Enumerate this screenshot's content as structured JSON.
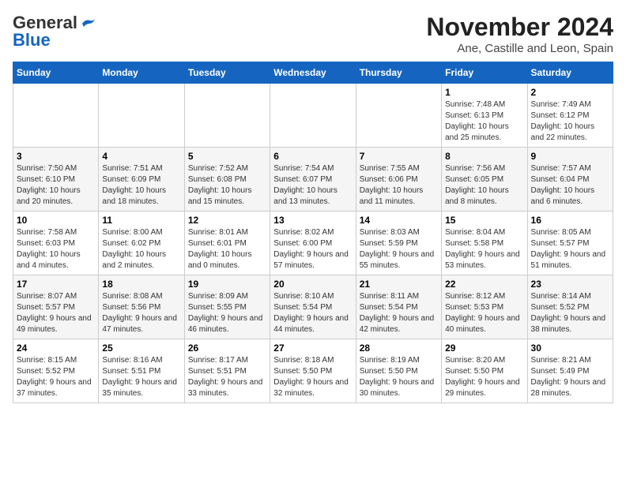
{
  "logo": {
    "general": "General",
    "blue": "Blue"
  },
  "title": "November 2024",
  "location": "Ane, Castille and Leon, Spain",
  "days_of_week": [
    "Sunday",
    "Monday",
    "Tuesday",
    "Wednesday",
    "Thursday",
    "Friday",
    "Saturday"
  ],
  "weeks": [
    [
      {
        "day": "",
        "info": ""
      },
      {
        "day": "",
        "info": ""
      },
      {
        "day": "",
        "info": ""
      },
      {
        "day": "",
        "info": ""
      },
      {
        "day": "",
        "info": ""
      },
      {
        "day": "1",
        "info": "Sunrise: 7:48 AM\nSunset: 6:13 PM\nDaylight: 10 hours and 25 minutes."
      },
      {
        "day": "2",
        "info": "Sunrise: 7:49 AM\nSunset: 6:12 PM\nDaylight: 10 hours and 22 minutes."
      }
    ],
    [
      {
        "day": "3",
        "info": "Sunrise: 7:50 AM\nSunset: 6:10 PM\nDaylight: 10 hours and 20 minutes."
      },
      {
        "day": "4",
        "info": "Sunrise: 7:51 AM\nSunset: 6:09 PM\nDaylight: 10 hours and 18 minutes."
      },
      {
        "day": "5",
        "info": "Sunrise: 7:52 AM\nSunset: 6:08 PM\nDaylight: 10 hours and 15 minutes."
      },
      {
        "day": "6",
        "info": "Sunrise: 7:54 AM\nSunset: 6:07 PM\nDaylight: 10 hours and 13 minutes."
      },
      {
        "day": "7",
        "info": "Sunrise: 7:55 AM\nSunset: 6:06 PM\nDaylight: 10 hours and 11 minutes."
      },
      {
        "day": "8",
        "info": "Sunrise: 7:56 AM\nSunset: 6:05 PM\nDaylight: 10 hours and 8 minutes."
      },
      {
        "day": "9",
        "info": "Sunrise: 7:57 AM\nSunset: 6:04 PM\nDaylight: 10 hours and 6 minutes."
      }
    ],
    [
      {
        "day": "10",
        "info": "Sunrise: 7:58 AM\nSunset: 6:03 PM\nDaylight: 10 hours and 4 minutes."
      },
      {
        "day": "11",
        "info": "Sunrise: 8:00 AM\nSunset: 6:02 PM\nDaylight: 10 hours and 2 minutes."
      },
      {
        "day": "12",
        "info": "Sunrise: 8:01 AM\nSunset: 6:01 PM\nDaylight: 10 hours and 0 minutes."
      },
      {
        "day": "13",
        "info": "Sunrise: 8:02 AM\nSunset: 6:00 PM\nDaylight: 9 hours and 57 minutes."
      },
      {
        "day": "14",
        "info": "Sunrise: 8:03 AM\nSunset: 5:59 PM\nDaylight: 9 hours and 55 minutes."
      },
      {
        "day": "15",
        "info": "Sunrise: 8:04 AM\nSunset: 5:58 PM\nDaylight: 9 hours and 53 minutes."
      },
      {
        "day": "16",
        "info": "Sunrise: 8:05 AM\nSunset: 5:57 PM\nDaylight: 9 hours and 51 minutes."
      }
    ],
    [
      {
        "day": "17",
        "info": "Sunrise: 8:07 AM\nSunset: 5:57 PM\nDaylight: 9 hours and 49 minutes."
      },
      {
        "day": "18",
        "info": "Sunrise: 8:08 AM\nSunset: 5:56 PM\nDaylight: 9 hours and 47 minutes."
      },
      {
        "day": "19",
        "info": "Sunrise: 8:09 AM\nSunset: 5:55 PM\nDaylight: 9 hours and 46 minutes."
      },
      {
        "day": "20",
        "info": "Sunrise: 8:10 AM\nSunset: 5:54 PM\nDaylight: 9 hours and 44 minutes."
      },
      {
        "day": "21",
        "info": "Sunrise: 8:11 AM\nSunset: 5:54 PM\nDaylight: 9 hours and 42 minutes."
      },
      {
        "day": "22",
        "info": "Sunrise: 8:12 AM\nSunset: 5:53 PM\nDaylight: 9 hours and 40 minutes."
      },
      {
        "day": "23",
        "info": "Sunrise: 8:14 AM\nSunset: 5:52 PM\nDaylight: 9 hours and 38 minutes."
      }
    ],
    [
      {
        "day": "24",
        "info": "Sunrise: 8:15 AM\nSunset: 5:52 PM\nDaylight: 9 hours and 37 minutes."
      },
      {
        "day": "25",
        "info": "Sunrise: 8:16 AM\nSunset: 5:51 PM\nDaylight: 9 hours and 35 minutes."
      },
      {
        "day": "26",
        "info": "Sunrise: 8:17 AM\nSunset: 5:51 PM\nDaylight: 9 hours and 33 minutes."
      },
      {
        "day": "27",
        "info": "Sunrise: 8:18 AM\nSunset: 5:50 PM\nDaylight: 9 hours and 32 minutes."
      },
      {
        "day": "28",
        "info": "Sunrise: 8:19 AM\nSunset: 5:50 PM\nDaylight: 9 hours and 30 minutes."
      },
      {
        "day": "29",
        "info": "Sunrise: 8:20 AM\nSunset: 5:50 PM\nDaylight: 9 hours and 29 minutes."
      },
      {
        "day": "30",
        "info": "Sunrise: 8:21 AM\nSunset: 5:49 PM\nDaylight: 9 hours and 28 minutes."
      }
    ]
  ]
}
